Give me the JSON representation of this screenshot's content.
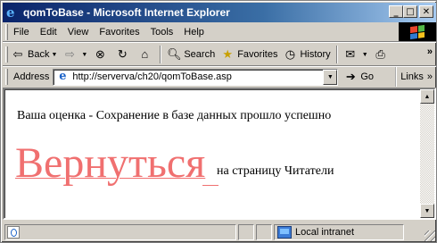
{
  "window": {
    "title": "qomToBase - Microsoft Internet Explorer",
    "min_label": "_",
    "max_label": "□",
    "close_label": "✕"
  },
  "menu": {
    "items": [
      "File",
      "Edit",
      "View",
      "Favorites",
      "Tools",
      "Help"
    ]
  },
  "toolbar": {
    "back_label": "Back",
    "search_label": "Search",
    "favorites_label": "Favorites",
    "history_label": "History",
    "more": "»"
  },
  "address": {
    "label": "Address",
    "url": "http://serverva/ch20/qomToBase.asp",
    "go_label": "Go",
    "links_label": "Links",
    "links_more": "»"
  },
  "page": {
    "message": "Ваша оценка - Сохранение в базе данных прошло успешно",
    "back_link": "Вернуться",
    "back_suffix": "на страницу Читатели",
    "link_color": "#f07070"
  },
  "status": {
    "main_text": "",
    "zone": "Local intranet"
  }
}
